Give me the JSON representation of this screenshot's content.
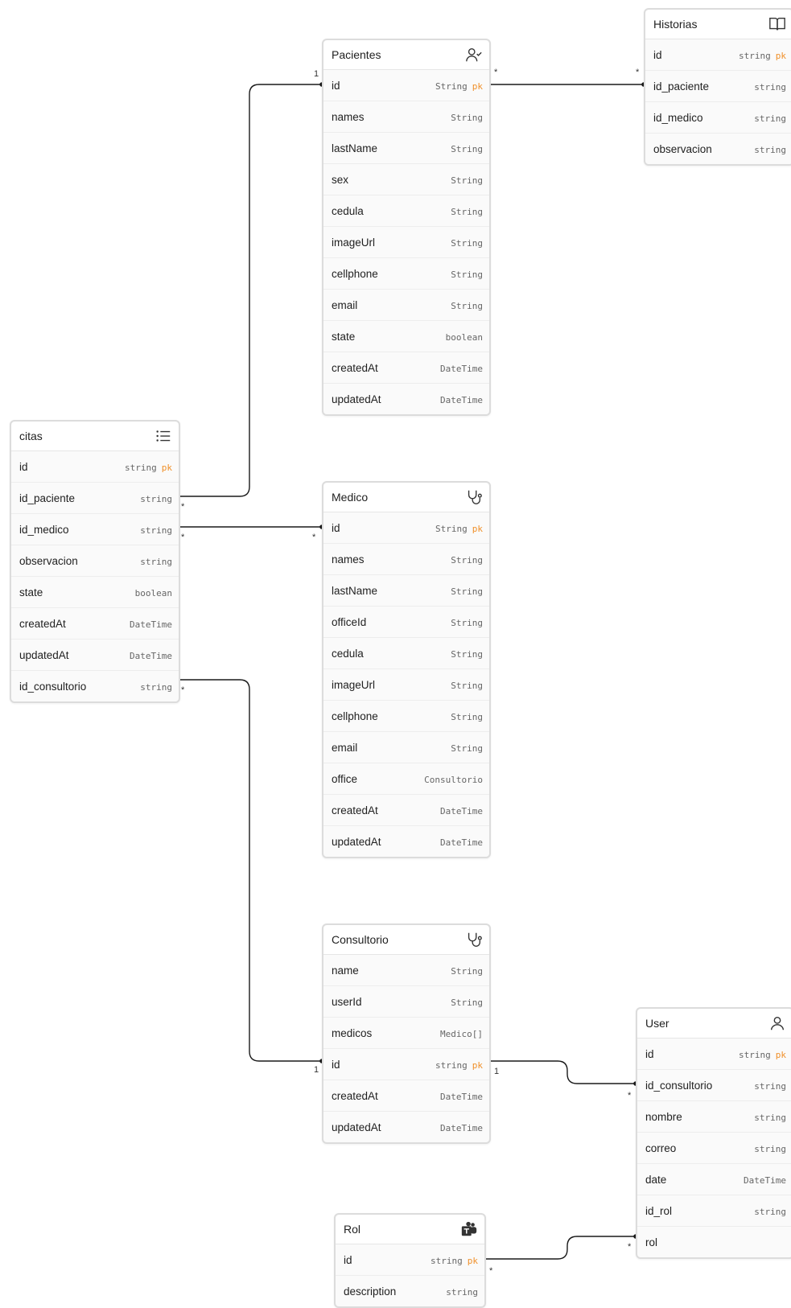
{
  "tables": {
    "pacientes": {
      "title": "Pacientes",
      "icon": "user-check-icon",
      "rows": [
        {
          "name": "id",
          "type": "String",
          "pk": "pk"
        },
        {
          "name": "names",
          "type": "String"
        },
        {
          "name": "lastName",
          "type": "String"
        },
        {
          "name": "sex",
          "type": "String"
        },
        {
          "name": "cedula",
          "type": "String"
        },
        {
          "name": "imageUrl",
          "type": "String"
        },
        {
          "name": "cellphone",
          "type": "String"
        },
        {
          "name": "email",
          "type": "String"
        },
        {
          "name": "state",
          "type": "boolean"
        },
        {
          "name": "createdAt",
          "type": "DateTime"
        },
        {
          "name": "updatedAt",
          "type": "DateTime"
        }
      ]
    },
    "historias": {
      "title": "Historias",
      "icon": "book-open-icon",
      "rows": [
        {
          "name": "id",
          "type": "string",
          "pk": "pk"
        },
        {
          "name": "id_paciente",
          "type": "string"
        },
        {
          "name": "id_medico",
          "type": "string"
        },
        {
          "name": "observacion",
          "type": "string"
        }
      ]
    },
    "citas": {
      "title": "citas",
      "icon": "list-icon",
      "rows": [
        {
          "name": "id",
          "type": "string",
          "pk": "pk"
        },
        {
          "name": "id_paciente",
          "type": "string"
        },
        {
          "name": "id_medico",
          "type": "string"
        },
        {
          "name": "observacion",
          "type": "string"
        },
        {
          "name": "state",
          "type": "boolean"
        },
        {
          "name": "createdAt",
          "type": "DateTime"
        },
        {
          "name": "updatedAt",
          "type": "DateTime"
        },
        {
          "name": "id_consultorio",
          "type": "string"
        }
      ]
    },
    "medico": {
      "title": "Medico",
      "icon": "stethoscope-icon",
      "rows": [
        {
          "name": "id",
          "type": "String",
          "pk": "pk"
        },
        {
          "name": "names",
          "type": "String"
        },
        {
          "name": "lastName",
          "type": "String"
        },
        {
          "name": "officeId",
          "type": "String"
        },
        {
          "name": "cedula",
          "type": "String"
        },
        {
          "name": "imageUrl",
          "type": "String"
        },
        {
          "name": "cellphone",
          "type": "String"
        },
        {
          "name": "email",
          "type": "String"
        },
        {
          "name": "office",
          "type": "Consultorio"
        },
        {
          "name": "createdAt",
          "type": "DateTime"
        },
        {
          "name": "updatedAt",
          "type": "DateTime"
        }
      ]
    },
    "consultorio": {
      "title": "Consultorio",
      "icon": "stethoscope-icon",
      "rows": [
        {
          "name": "name",
          "type": "String"
        },
        {
          "name": "userId",
          "type": "String"
        },
        {
          "name": "medicos",
          "type": "Medico[]"
        },
        {
          "name": "id",
          "type": "string",
          "pk": "pk"
        },
        {
          "name": "createdAt",
          "type": "DateTime"
        },
        {
          "name": "updatedAt",
          "type": "DateTime"
        }
      ]
    },
    "user": {
      "title": "User",
      "icon": "user-icon",
      "rows": [
        {
          "name": "id",
          "type": "string",
          "pk": "pk"
        },
        {
          "name": "id_consultorio",
          "type": "string"
        },
        {
          "name": "nombre",
          "type": "string"
        },
        {
          "name": "correo",
          "type": "string"
        },
        {
          "name": "date",
          "type": "DateTime"
        },
        {
          "name": "id_rol",
          "type": "string"
        },
        {
          "name": "rol",
          "type": ""
        }
      ]
    },
    "rol": {
      "title": "Rol",
      "icon": "teams-icon",
      "rows": [
        {
          "name": "id",
          "type": "string",
          "pk": "pk"
        },
        {
          "name": "description",
          "type": "string"
        }
      ]
    }
  },
  "cardinality": {
    "one": "1",
    "many": "*"
  },
  "colors": {
    "pk": "#f0902a",
    "line": "#1a1a1a",
    "border": "#dcdcdc"
  }
}
